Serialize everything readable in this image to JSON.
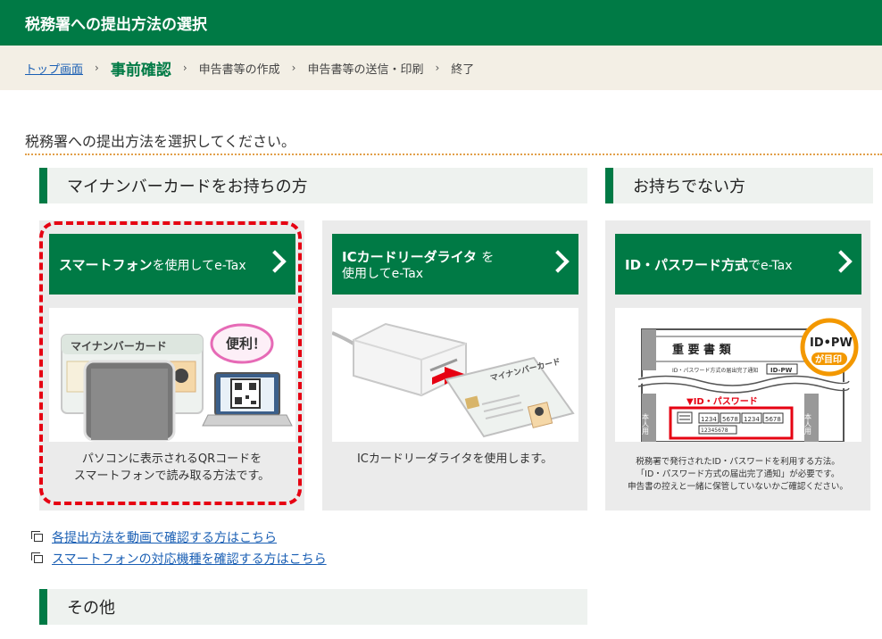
{
  "header": {
    "title": "税務署への提出方法の選択"
  },
  "breadcrumb": {
    "items": [
      "トップ画面",
      "事前確認",
      "申告書等の作成",
      "申告書等の送信・印刷",
      "終了"
    ],
    "separator": "›"
  },
  "instruction": "税務署への提出方法を選択してください。",
  "sections": {
    "with_card": "マイナンバーカードをお持ちの方",
    "without_card": "お持ちでない方",
    "other": "その他"
  },
  "cards": [
    {
      "button_bold": "スマートフォン",
      "button_rest": "を使用してe-Tax",
      "desc_line1": "パソコンに表示されるQRコードを",
      "desc_line2": "スマートフォンで読み取る方法です。",
      "illustration": {
        "card_label": "マイナンバーカード",
        "bubble": "便利！"
      }
    },
    {
      "button_bold": "ICカードリーダライタ",
      "button_rest": "を",
      "button_line2": "使用してe-Tax",
      "desc_line1": "ICカードリーダライタを使用します。",
      "illustration": {
        "card_label": "マイナンバーカード"
      }
    },
    {
      "button_bold": "ID・パスワード方式",
      "button_rest": "でe-Tax",
      "desc_line1": "税務署で発行されたID・パスワードを利用する方法。",
      "desc_line2": "「ID・パスワード方式の届出完了通知」が必要です。",
      "desc_line3": "申告書の控えと一緒に保管していないかご確認ください。",
      "illustration": {
        "doc_title": "重 要 書 類",
        "doc_sub": "ID・パスワード方式の届出完了通知",
        "doc_tag": "ID-PW",
        "pw_label": "▼ID・パスワード",
        "pw_cells": [
          "1234",
          "5678",
          "1234",
          "5678"
        ],
        "pw_num": "12345678",
        "side_text": "本人用",
        "badge1": "ID•PW",
        "badge2": "が目印"
      }
    }
  ],
  "links": [
    "各提出方法を動画で確認する方はこちら",
    "スマートフォンの対応機種を確認する方はこちら"
  ],
  "colors": {
    "brand_green": "#007a45",
    "highlight_red": "#e60012",
    "link_blue": "#1a5fb4"
  },
  "icons": [
    "chevron-right-icon",
    "new-window-icon"
  ]
}
